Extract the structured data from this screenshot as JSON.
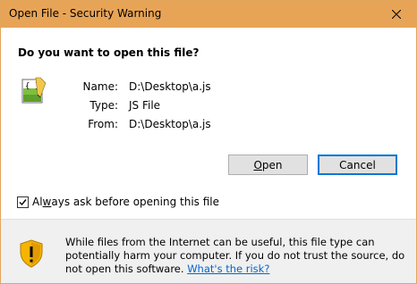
{
  "window": {
    "title": "Open File - Security Warning",
    "close_glyph": "✕",
    "accent": "#e8a456"
  },
  "question": "Do you want to open this file?",
  "file": {
    "icon": "js-file-icon",
    "fields": [
      {
        "label": "Name:",
        "value": "D:\\Desktop\\a.js"
      },
      {
        "label": "Type:",
        "value": "JS File"
      },
      {
        "label": "From:",
        "value": "D:\\Desktop\\a.js"
      }
    ]
  },
  "buttons": {
    "open_label": "Open",
    "open_mnemonic": "O",
    "open_rest": "pen",
    "cancel_label": "Cancel"
  },
  "checkbox": {
    "checked": true,
    "label": "Always ask before opening this file",
    "label_before": "Al",
    "label_mnemonic": "w",
    "label_after": "ays ask before opening this file"
  },
  "warning": {
    "icon": "shield-warning-icon",
    "text": "While files from the Internet can be useful, this file type can potentially harm your computer. If you do not trust the source, do not open this software.",
    "link": "What's the risk?"
  }
}
